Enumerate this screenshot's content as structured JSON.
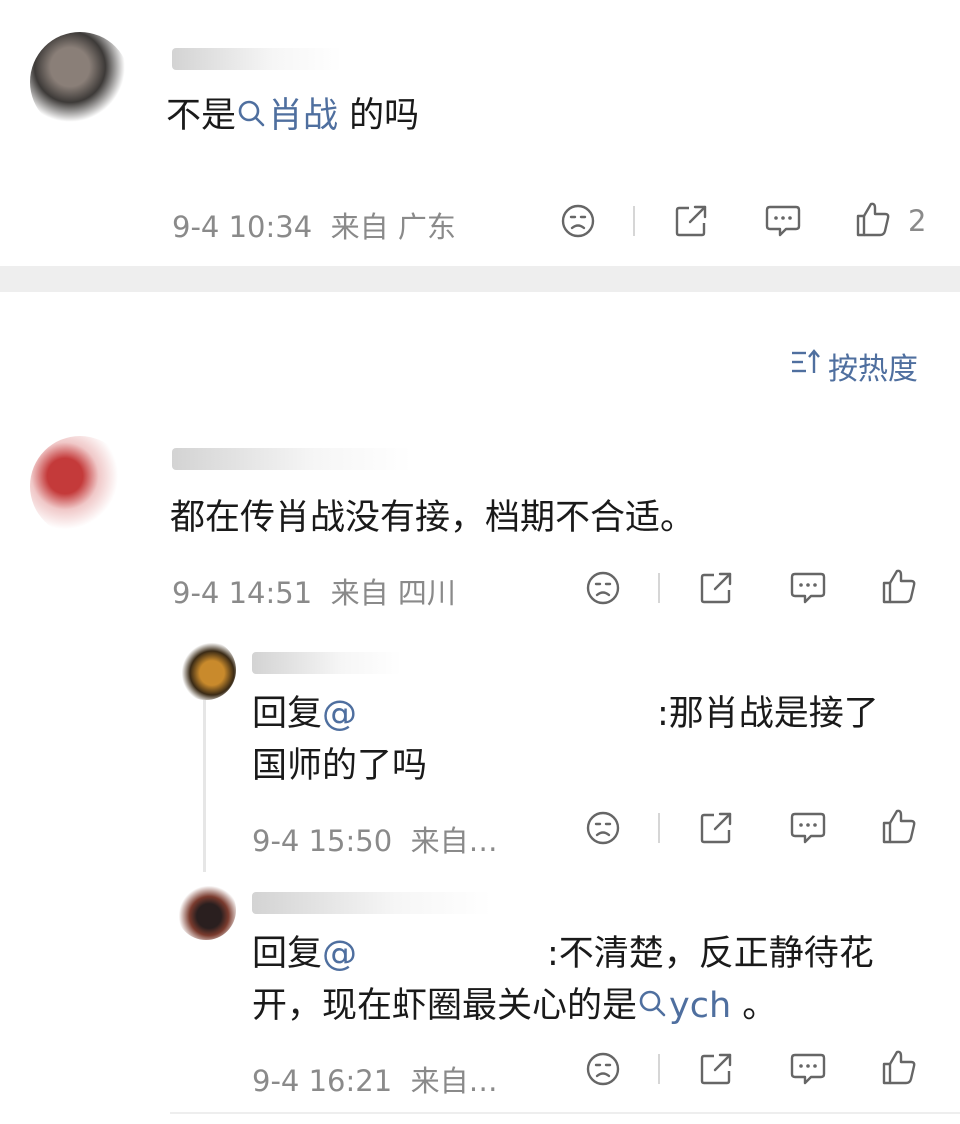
{
  "comments": [
    {
      "prefix": "不是",
      "topic": "肖战",
      "suffix": "的吗",
      "time": "9-4 10:34",
      "location": "来自 广东",
      "likes": "2"
    },
    {
      "text": "都在传肖战没有接，档期不合适。",
      "time": "9-4 14:51",
      "location": "来自 四川"
    }
  ],
  "sort_label": "按热度",
  "replies": [
    {
      "reply_word": "回复",
      "line1_tail": ":那肖战是接了",
      "line2": "国师的了吗",
      "time": "9-4 15:50",
      "location": "来自…"
    },
    {
      "reply_word": "回复",
      "line1_tail": ":不清楚，反正静待花",
      "line2_prefix": "开，现在虾圈最关心的是",
      "topic": "ych",
      "line2_suffix": "。",
      "time": "9-4 16:21",
      "location": "来自…"
    }
  ],
  "icons": [
    "dislike-icon",
    "share-icon",
    "comment-icon",
    "like-icon",
    "sort-icon",
    "topic-search-icon"
  ],
  "colors": {
    "link": "#4f6f9f",
    "meta": "#8a8a8a",
    "divider": "#eeeeee"
  }
}
